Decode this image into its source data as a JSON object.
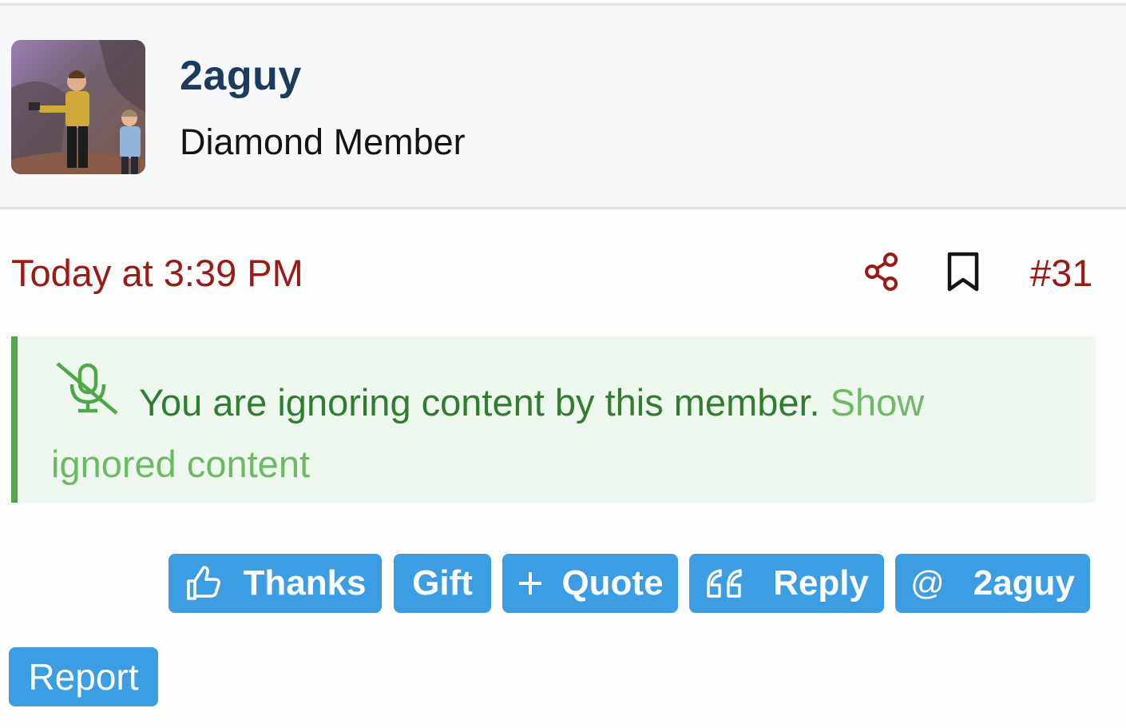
{
  "user": {
    "username": "2aguy",
    "title": "Diamond Member",
    "avatar_icon": "avatar-image"
  },
  "post": {
    "date": "Today at 3:39 PM",
    "number": "#31",
    "share_icon": "share-icon",
    "bookmark_icon": "bookmark-icon"
  },
  "ignored_notice": {
    "icon": "mute-icon",
    "message": "You are ignoring content by this member.",
    "link": "Show ignored content"
  },
  "actions": {
    "thanks": {
      "label": "Thanks",
      "icon": "thumbs-up-icon"
    },
    "gift": {
      "label": "Gift"
    },
    "quote": {
      "label": "Quote",
      "icon": "plus-icon"
    },
    "reply": {
      "label": "Reply",
      "icon": "quote-marks-icon"
    },
    "mention": {
      "label": "2aguy",
      "icon": "at-icon"
    },
    "report": {
      "label": "Report"
    }
  },
  "colors": {
    "accent": "#3d9de3",
    "date": "#9b1a14",
    "username": "#1c3b5e",
    "notice_bg": "#eff8ee",
    "notice_border": "#4ea84a",
    "notice_text": "#2f7d2f",
    "notice_link": "#6cba64"
  }
}
